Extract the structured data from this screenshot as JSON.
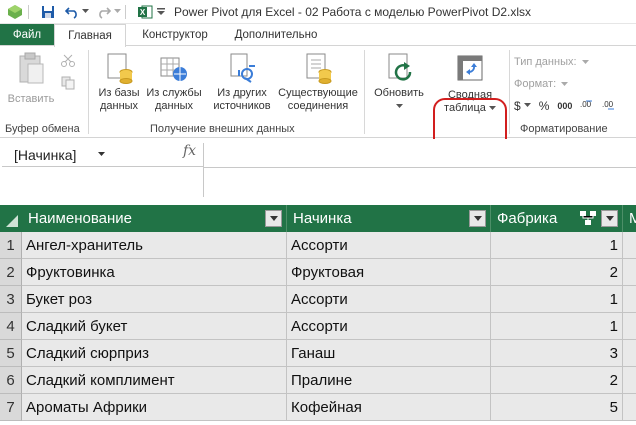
{
  "window": {
    "title": "Power Pivot для Excel - 02 Работа с моделью PowerPivot D2.xlsx"
  },
  "tabs": [
    "Файл",
    "Главная",
    "Конструктор",
    "Дополнительно"
  ],
  "ribbon": {
    "paste": "Вставить",
    "clipboard_group": "Буфер обмена",
    "from_db": [
      "Из базы",
      "данных"
    ],
    "from_service": [
      "Из службы",
      "данных"
    ],
    "from_other": [
      "Из других",
      "источников"
    ],
    "existing": [
      "Существующие",
      "соединения"
    ],
    "get_data_group": "Получение внешних данных",
    "refresh": "Обновить",
    "pivot": [
      "Сводная",
      "таблица"
    ],
    "data_type": "Тип данных:",
    "format": "Формат:",
    "currency": "$",
    "percent": "%",
    "comma": "000",
    "formatting_group": "Форматирование"
  },
  "formula_bar": {
    "name_box": "[Начинка]",
    "fx": "fx"
  },
  "table": {
    "columns": [
      "Наименование",
      "Начинка",
      "Фабрика",
      "M"
    ],
    "rows": [
      {
        "n": "1",
        "name": "Ангел-хранитель",
        "filling": "Ассорти",
        "factory": "1"
      },
      {
        "n": "2",
        "name": "Фруктовинка",
        "filling": "Фруктовая",
        "factory": "2"
      },
      {
        "n": "3",
        "name": "Букет роз",
        "filling": "Ассорти",
        "factory": "1"
      },
      {
        "n": "4",
        "name": "Сладкий букет",
        "filling": "Ассорти",
        "factory": "1"
      },
      {
        "n": "5",
        "name": "Сладкий сюрприз",
        "filling": "Ганаш",
        "factory": "3"
      },
      {
        "n": "6",
        "name": "Сладкий комплимент",
        "filling": "Пралине",
        "factory": "2"
      },
      {
        "n": "7",
        "name": "Ароматы Африки",
        "filling": "Кофейная",
        "factory": "5"
      }
    ]
  },
  "colors": {
    "accent": "#217346",
    "highlight": "#d21e1e"
  }
}
